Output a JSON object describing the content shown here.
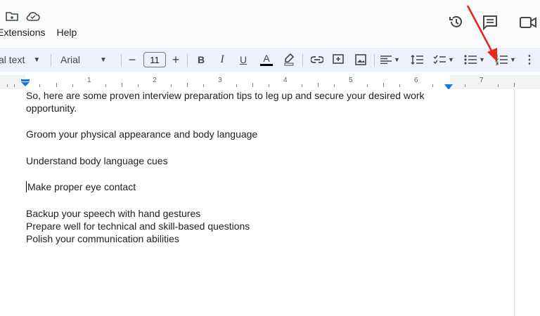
{
  "menu": {
    "items": [
      "Extensions",
      "Help"
    ]
  },
  "toolbar": {
    "style_label": "al text",
    "font_label": "Arial",
    "font_size": "11",
    "minus": "−",
    "plus": "+",
    "bold": "B",
    "italic": "I",
    "underline": "U",
    "text_color": "A"
  },
  "ruler": {
    "numbers": [
      "1",
      "2",
      "3",
      "4",
      "5",
      "6",
      "7"
    ]
  },
  "document": {
    "lines": [
      "So, here are some proven interview preparation tips to leg up and secure your desired work",
      "opportunity.",
      "Groom your physical appearance and body language",
      "Understand body language cues",
      "Make proper eye contact",
      "Backup your speech with hand gestures",
      "Prepare well for technical and skill-based questions",
      "Polish your communication abilities"
    ]
  },
  "colors": {
    "accent": "#1a73e8",
    "arrow": "#e8261f",
    "toolbar_bg": "#edf2fa"
  }
}
